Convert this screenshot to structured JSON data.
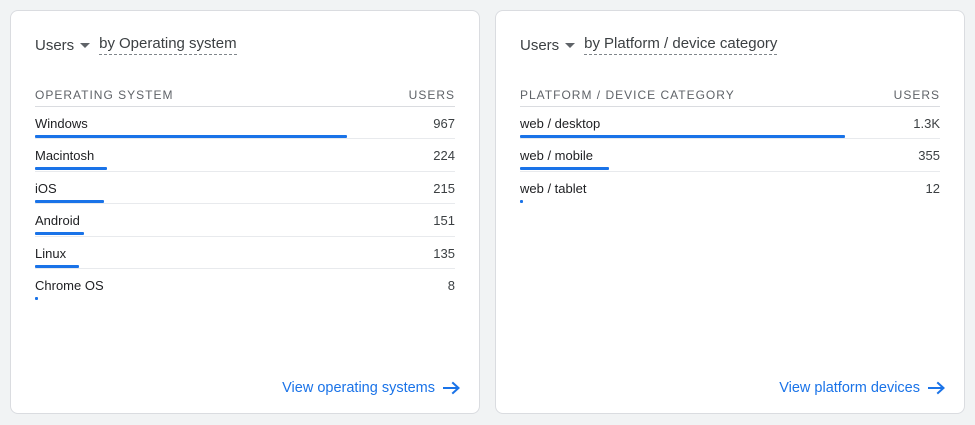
{
  "accent_color": "#1a73e8",
  "cards": [
    {
      "metric": "Users",
      "dimension_prefix": "by",
      "dimension": "Operating system",
      "column_dimension": "OPERATING SYSTEM",
      "column_metric": "USERS",
      "max_value": 1300,
      "rows": [
        {
          "label": "Windows",
          "value": "967",
          "numeric": 967
        },
        {
          "label": "Macintosh",
          "value": "224",
          "numeric": 224
        },
        {
          "label": "iOS",
          "value": "215",
          "numeric": 215
        },
        {
          "label": "Android",
          "value": "151",
          "numeric": 151
        },
        {
          "label": "Linux",
          "value": "135",
          "numeric": 135
        },
        {
          "label": "Chrome OS",
          "value": "8",
          "numeric": 8
        }
      ],
      "link_label": "View operating systems"
    },
    {
      "metric": "Users",
      "dimension_prefix": "by",
      "dimension": "Platform / device category",
      "column_dimension": "PLATFORM / DEVICE CATEGORY",
      "column_metric": "USERS",
      "max_value": 1680,
      "rows": [
        {
          "label": "web / desktop",
          "value": "1.3K",
          "numeric": 1300
        },
        {
          "label": "web / mobile",
          "value": "355",
          "numeric": 355
        },
        {
          "label": "web / tablet",
          "value": "12",
          "numeric": 12
        }
      ],
      "link_label": "View platform devices"
    }
  ]
}
